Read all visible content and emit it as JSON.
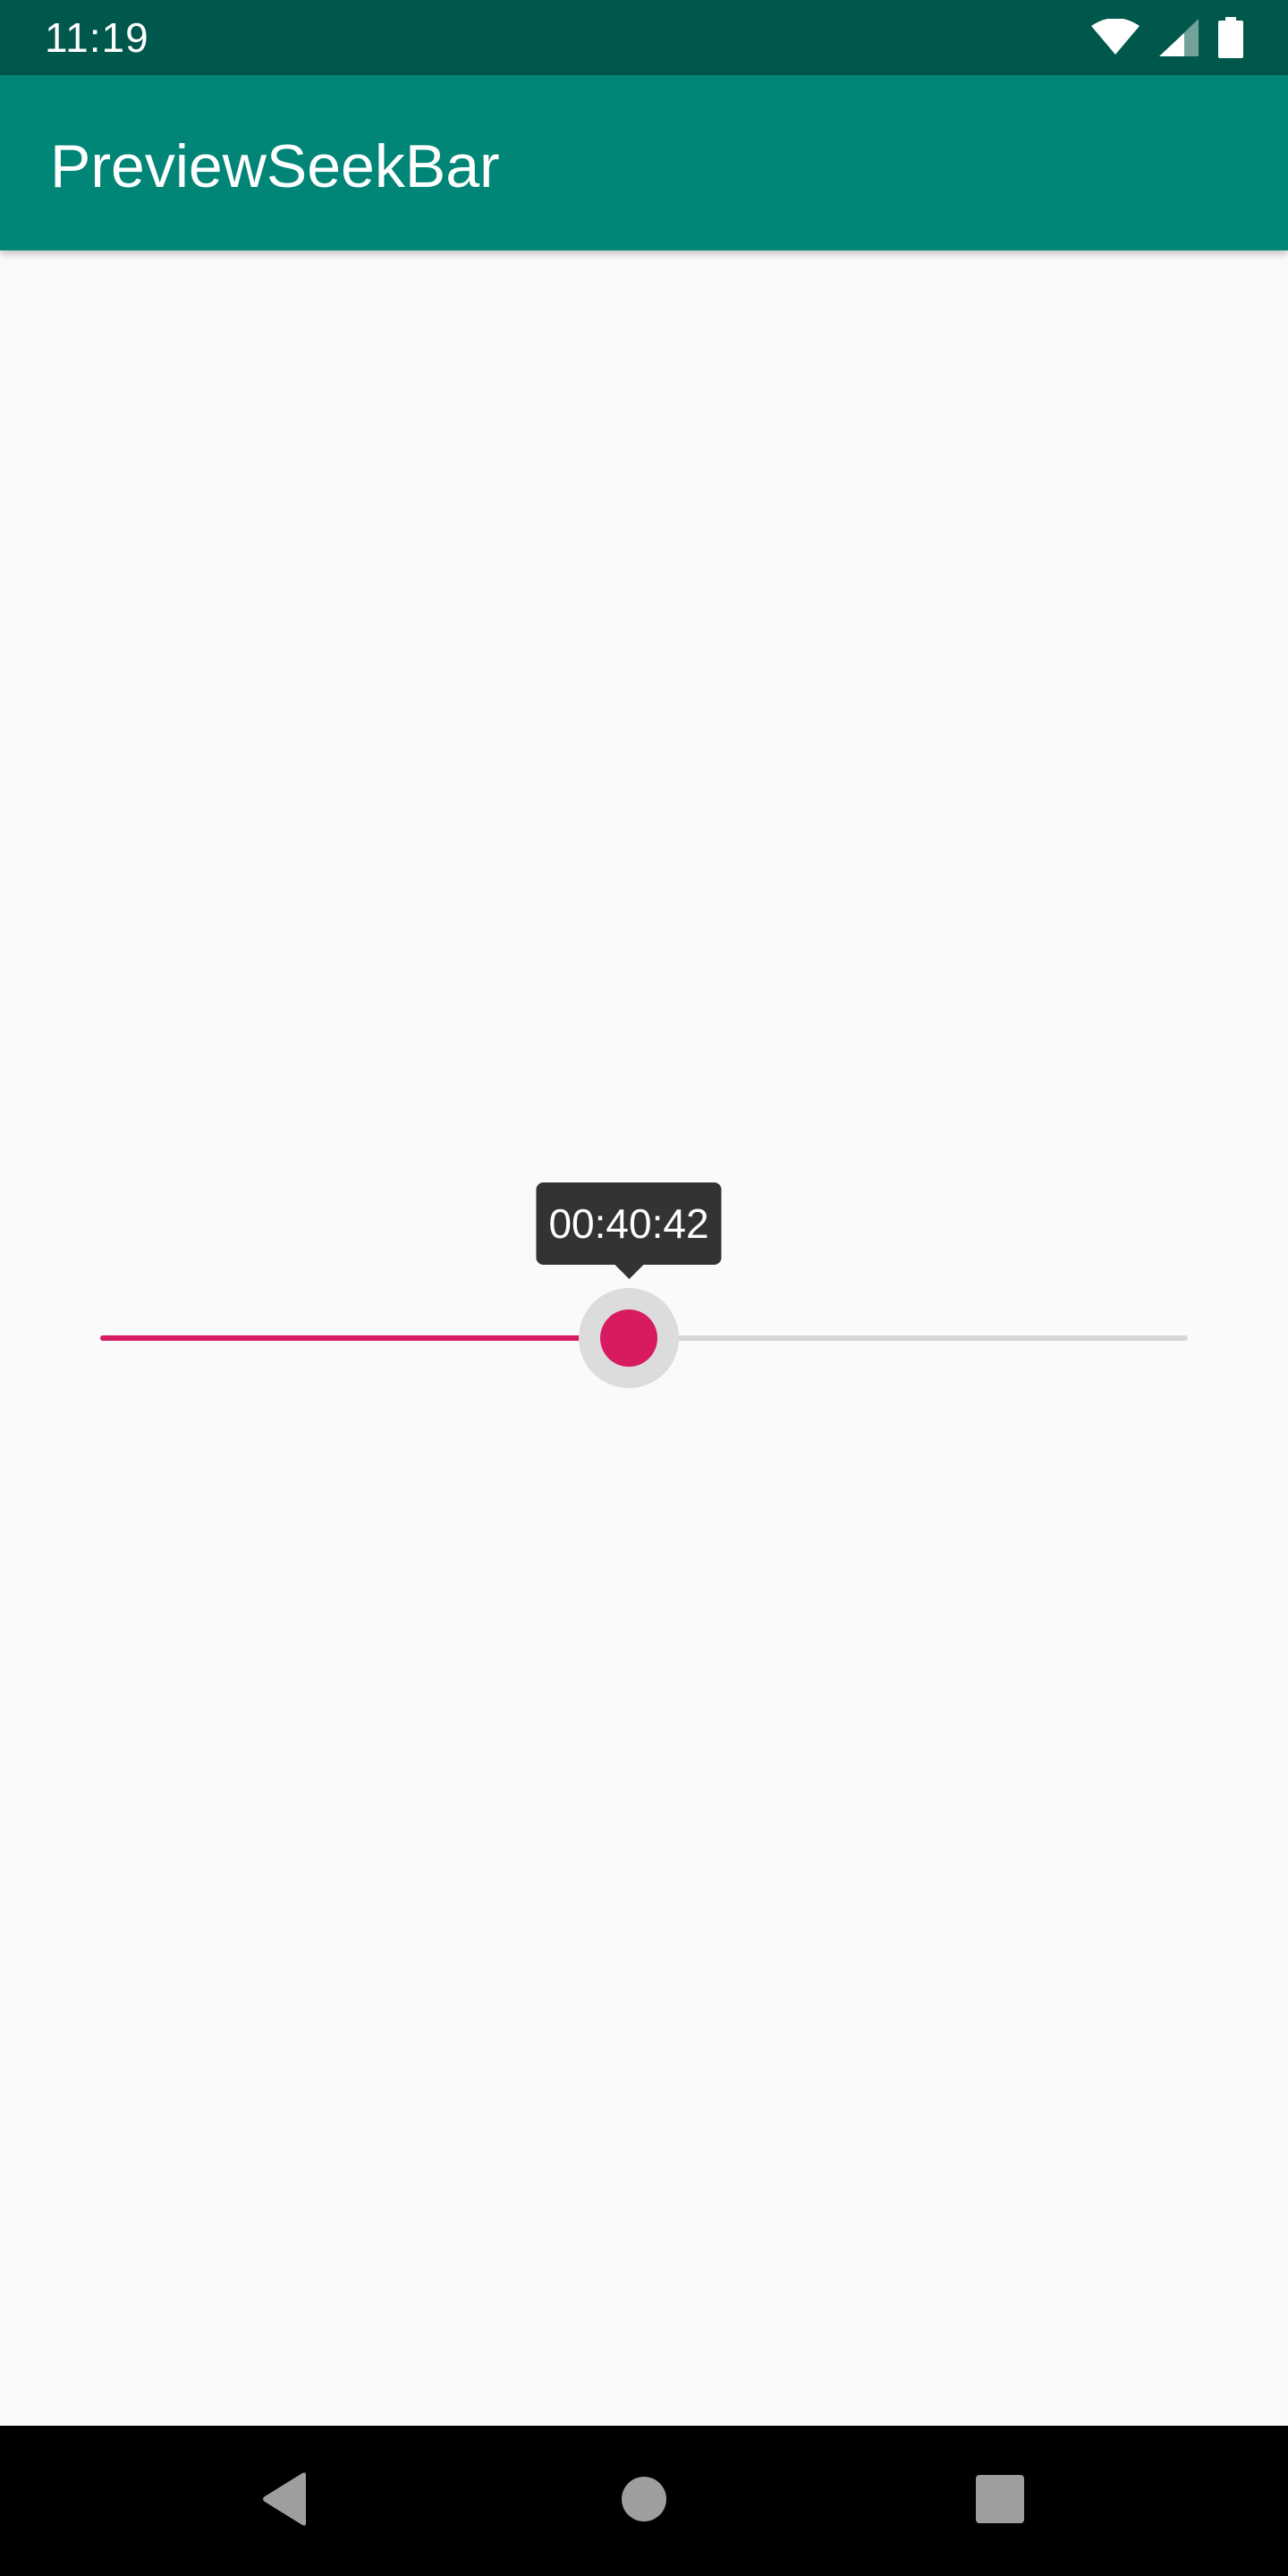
{
  "status_bar": {
    "time": "11:19",
    "icons": [
      "wifi-icon",
      "cell-signal-icon",
      "battery-icon"
    ]
  },
  "app_bar": {
    "title": "PreviewSeekBar"
  },
  "seekbar": {
    "progress_fraction": 0.486,
    "tooltip": "00:40:42",
    "colors": {
      "progress": "#d81b60",
      "track": "#d6d6d6",
      "thumb": "#d81b60",
      "halo": "#dcdcdc",
      "tooltip_bg": "#333333"
    }
  },
  "nav_bar": {
    "buttons": [
      "back-icon",
      "home-icon",
      "recents-icon"
    ]
  },
  "theme": {
    "primary": "#008577",
    "primary_dark": "#00574b",
    "accent": "#d81b60",
    "background": "#fafafa"
  }
}
